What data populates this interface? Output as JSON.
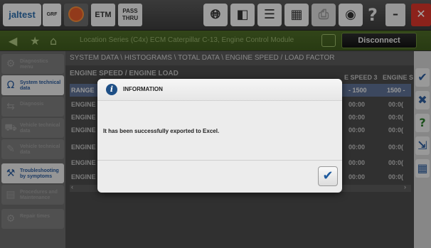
{
  "toolbar": {
    "logo": "jaltest",
    "grf": "GRF",
    "etm": "ETM",
    "pass_thru_1": "PASS",
    "pass_thru_2": "THRU",
    "help": "?",
    "minimize": "–",
    "maximize": "□",
    "close": "✕"
  },
  "crumbbar": {
    "path": "Location Series (C4x) ECM Caterpillar C-13, Engine Control Module",
    "disconnect_label": "Disconnect"
  },
  "sidebar": {
    "items": [
      {
        "label": "Diagnostics menu"
      },
      {
        "label": "System technical data"
      },
      {
        "label": "Diagnosis"
      },
      {
        "label": "Vehicle technical data"
      },
      {
        "label": "Vehicle technical data"
      },
      {
        "label": "Troubleshooting by symptoms"
      },
      {
        "label": "Procedures and Maintenance"
      },
      {
        "label": "Repair times"
      }
    ]
  },
  "main": {
    "path": "SYSTEM DATA \\ HISTOGRAMS \\ TOTAL DATA \\ ENGINE SPEED / LOAD FACTOR",
    "table_title": "ENGINE SPEED / ENGINE LOAD",
    "header": {
      "c1": "RANGE",
      "c2": "- 1500",
      "c3": "1500 -",
      "c4": "E SPEED 3",
      "c5": "ENGINE S"
    },
    "rows": [
      {
        "label": "ENGINE",
        "v1": "00:00",
        "v2": "00:0("
      },
      {
        "label": "ENGINE",
        "v1": "00:00",
        "v2": "00:0("
      },
      {
        "label": "ENGINE",
        "v1": "00:00",
        "v2": "00:0("
      },
      {
        "label": "ENGINE",
        "v1": "00:00",
        "v2": "00:0("
      },
      {
        "label": "ENGINE",
        "v1": "00:00",
        "v2": "00:0("
      },
      {
        "label": "ENGINE",
        "v1": "00:00",
        "v2": "00:0("
      }
    ]
  },
  "dialog": {
    "title": "INFORMATION",
    "message": "It has been successfully exported to Excel.",
    "ok": "✔"
  }
}
